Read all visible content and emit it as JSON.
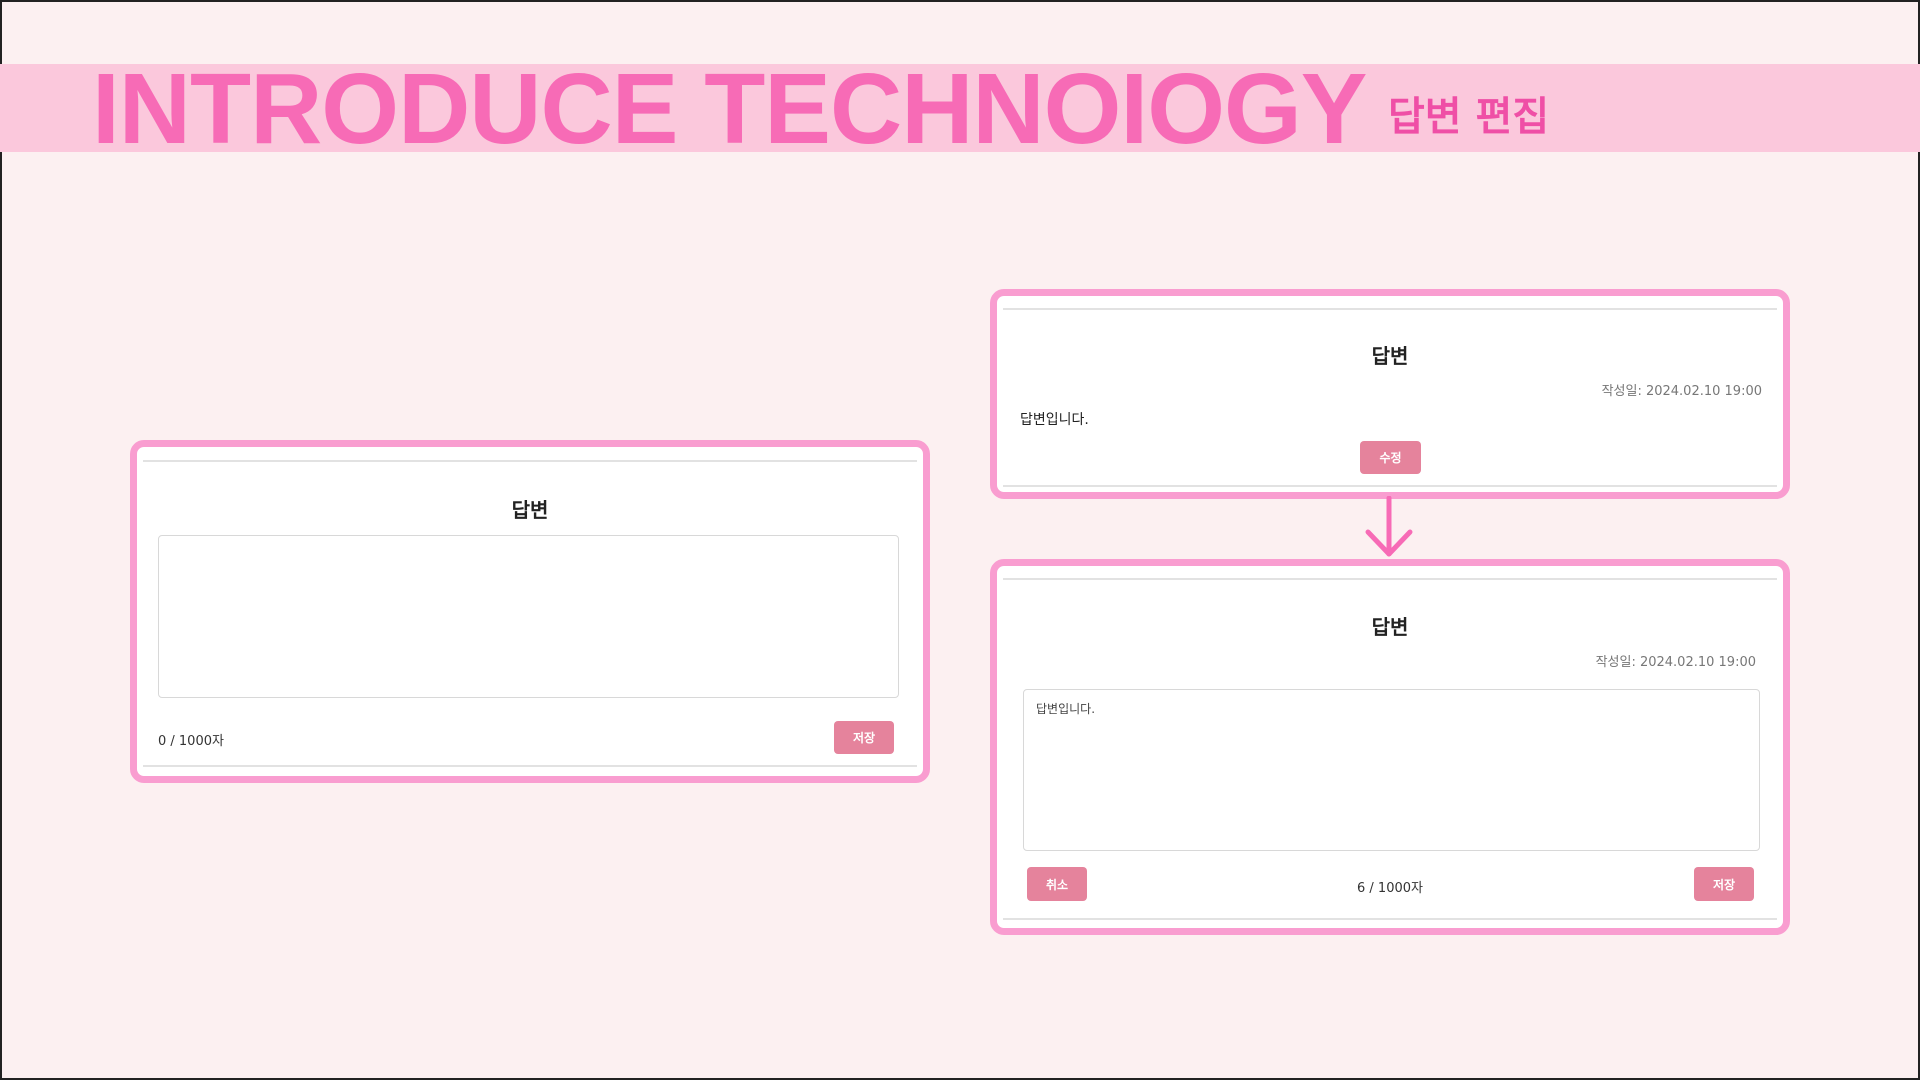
{
  "banner": {
    "title": "INTRODUCE TECHNOIOGY",
    "subtitle": "답변 편집"
  },
  "new_answer_card": {
    "title": "답변",
    "textarea_value": "",
    "counter": "0 / 1000자",
    "save_label": "저장"
  },
  "view_answer_card": {
    "title": "답변",
    "date": "작성일: 2024.02.10 19:00",
    "content": "답변입니다.",
    "edit_label": "수정"
  },
  "edit_answer_card": {
    "title": "답변",
    "date": "작성일: 2024.02.10 19:00",
    "textarea_value": "답변입니다.",
    "cancel_label": "취소",
    "counter": "6 / 1000자",
    "save_label": "저장"
  },
  "colors": {
    "background": "#fcf0f1",
    "banner": "#fbc8dc",
    "title_pink": "#f76bb6",
    "card_border": "#f99dd0",
    "button": "#e5839c"
  },
  "icons": {
    "flow_arrow": "arrow-down-icon"
  }
}
